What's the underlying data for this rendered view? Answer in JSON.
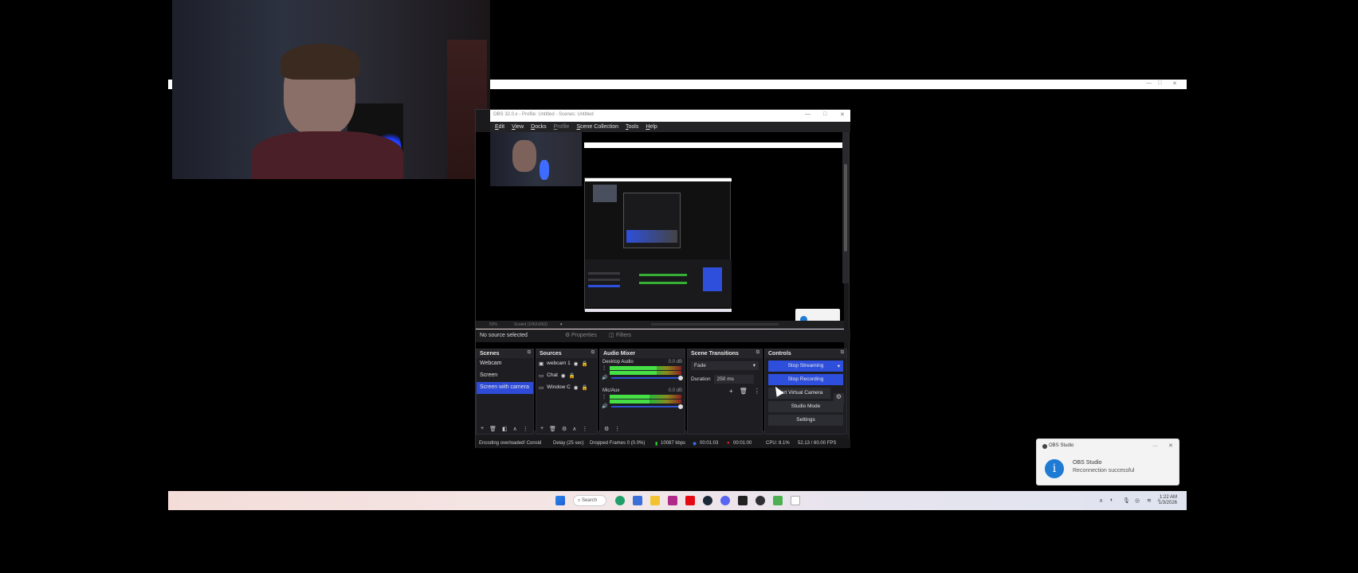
{
  "obs": {
    "title": "OBS 32.0.x - Profile: Untitled - Scenes: Untitled",
    "menu": [
      "Edit",
      "View",
      "Docks",
      "Profile",
      "Scene Collection",
      "Tools",
      "Help"
    ],
    "zoom": "53%",
    "scaled": "Scaled (1062x563)",
    "no_source": "No source selected",
    "properties": "Properties",
    "filters": "Filters",
    "scenes": {
      "title": "Scenes",
      "items": [
        "Webcam",
        "Screen",
        "Screen with camera"
      ],
      "active_index": 2
    },
    "sources": {
      "title": "Sources",
      "items": [
        "webcam 1",
        "Chat",
        "Window C"
      ]
    },
    "audio_mixer": {
      "title": "Audio Mixer",
      "channels": [
        {
          "name": "Desktop Audio",
          "db": "0.0 dB",
          "level": 0.65
        },
        {
          "name": "Mic/Aux",
          "db": "0.0 dB",
          "level": 0.55
        }
      ],
      "scale": "-60 -55 -50 -45 -40 -35 -30 -25 -20 -15 -10 -5 0"
    },
    "scene_transitions": {
      "title": "Scene Transitions",
      "transition": "Fade",
      "duration_label": "Duration",
      "duration": "250 ms"
    },
    "controls": {
      "title": "Controls",
      "stop_streaming": "Stop Streaming",
      "stop_recording": "Stop Recording",
      "virtual_camera": "Start Virtual Camera",
      "studio_mode": "Studio Mode",
      "settings": "Settings"
    },
    "status": {
      "encoding": "Encoding overloaded! Consid",
      "delay": "Delay (25 sec)",
      "dropped": "Dropped Frames 0 (0.0%)",
      "bitrate": "10087 kbps",
      "stream_time": "00:01:03",
      "rec_time": "00:01:00",
      "cpu": "CPU: 8.1%",
      "fps": "52.13 / 60.00 FPS"
    }
  },
  "notification": {
    "app": "OBS Studio",
    "title": "OBS Studio",
    "body": "Reconnection successful"
  },
  "taskbar": {
    "search": "Search",
    "time": "1:22 AM",
    "date": "1/3/2026"
  },
  "colors": {
    "accent": "#2e4fdb",
    "bg": "#1a1a1d",
    "notify_icon": "#1f7ad4"
  }
}
